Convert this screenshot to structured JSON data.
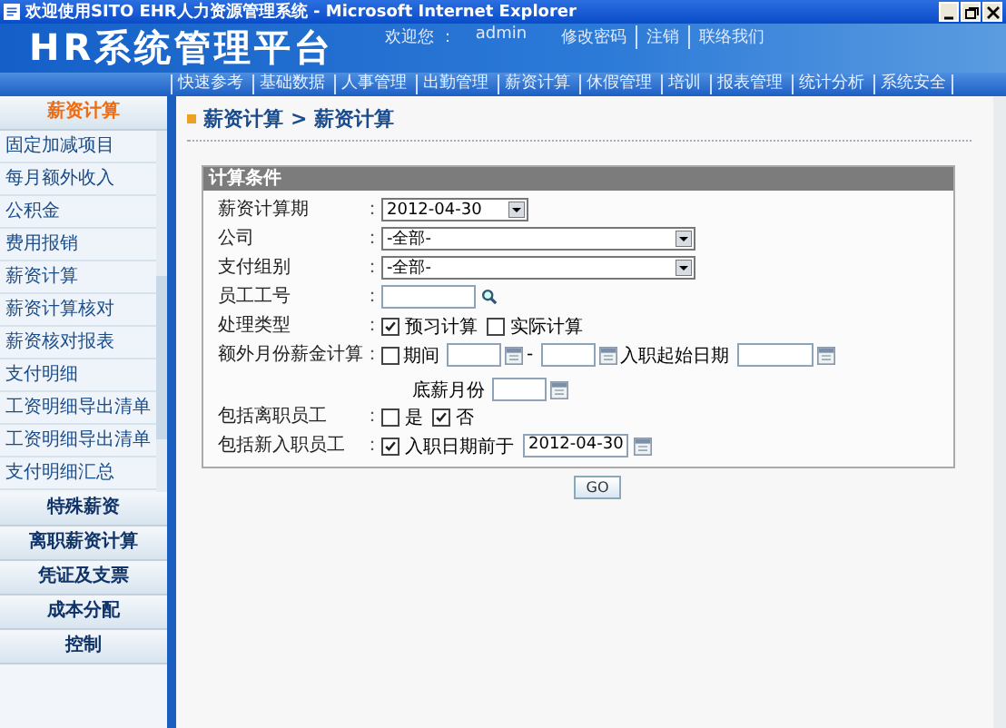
{
  "window": {
    "title": "欢迎使用SITO EHR人力资源管理系统 - Microsoft Internet Explorer"
  },
  "header": {
    "logo": "HR系统管理平台",
    "welcome": "欢迎您 ：",
    "user": "admin",
    "links": [
      "修改密码",
      "注销",
      "联络我们"
    ]
  },
  "nav": [
    {
      "label": "快速参考",
      "selected": false
    },
    {
      "label": "基础数据",
      "selected": false
    },
    {
      "label": "人事管理",
      "selected": false
    },
    {
      "label": "出勤管理",
      "selected": false
    },
    {
      "label": "薪资计算",
      "selected": false
    },
    {
      "label": "休假管理",
      "selected": false
    },
    {
      "label": "培训",
      "selected": false
    },
    {
      "label": "报表管理",
      "selected": false
    },
    {
      "label": "统计分析",
      "selected": false
    },
    {
      "label": "系统安全",
      "selected": false
    }
  ],
  "sidebar": [
    {
      "label": "薪资计算",
      "expanded": true,
      "items": [
        {
          "label": "固定加减项目",
          "selected": false
        },
        {
          "label": "每月额外收入",
          "selected": false
        },
        {
          "label": "公积金",
          "selected": false
        },
        {
          "label": "费用报销",
          "selected": false
        },
        {
          "label": "薪资计算",
          "selected": false
        },
        {
          "label": "薪资计算核对",
          "selected": false
        },
        {
          "label": "薪资核对报表",
          "selected": false
        },
        {
          "label": "支付明细",
          "selected": false
        },
        {
          "label": "工资明细导出清单",
          "selected": false
        },
        {
          "label": "工资明细导出清单",
          "selected": false
        },
        {
          "label": "支付明细汇总",
          "selected": false
        }
      ]
    },
    {
      "label": "特殊薪资",
      "expanded": false
    },
    {
      "label": "离职薪资计算",
      "expanded": false
    },
    {
      "label": "凭证及支票",
      "expanded": false
    },
    {
      "label": "成本分配",
      "expanded": false
    },
    {
      "label": "控制",
      "expanded": false
    }
  ],
  "breadcrumb": [
    "薪资计算",
    "> 薪资计算"
  ],
  "panel": {
    "title": "计算条件",
    "rows": [
      {
        "kind": "date_select",
        "label": "薪资计算期",
        "colon": "：",
        "value": "2012-04-30"
      },
      {
        "kind": "select",
        "label": "公司",
        "colon": "：",
        "value": "-全部-"
      },
      {
        "kind": "select",
        "label": "支付组别",
        "colon": "：",
        "value": "-全部-"
      },
      {
        "kind": "lookup",
        "label": "员工工号",
        "colon": "："
      },
      {
        "kind": "checks",
        "label": "处理类型",
        "colon": "：",
        "options": [
          {
            "label": "预习计算",
            "checked": true
          },
          {
            "label": "实际计算",
            "checked": false
          }
        ]
      },
      {
        "kind": "extra",
        "label": "额外月份薪金计算",
        "colon": "：",
        "period": {
          "label": "期间",
          "checked": false
        },
        "separator": "-",
        "hire_label": "入职起始日期",
        "month_label": "底薪月份"
      },
      {
        "kind": "checks",
        "label": "包括离职员工",
        "colon": "：",
        "options": [
          {
            "label": "是",
            "checked": false
          },
          {
            "label": "否",
            "checked": true
          }
        ]
      },
      {
        "kind": "datecheck",
        "label": "包括新入职员工",
        "colon": "：",
        "option": {
          "label": "入职日期前于",
          "checked": true
        },
        "value": "2012-04-30"
      }
    ]
  },
  "submit": "GO"
}
